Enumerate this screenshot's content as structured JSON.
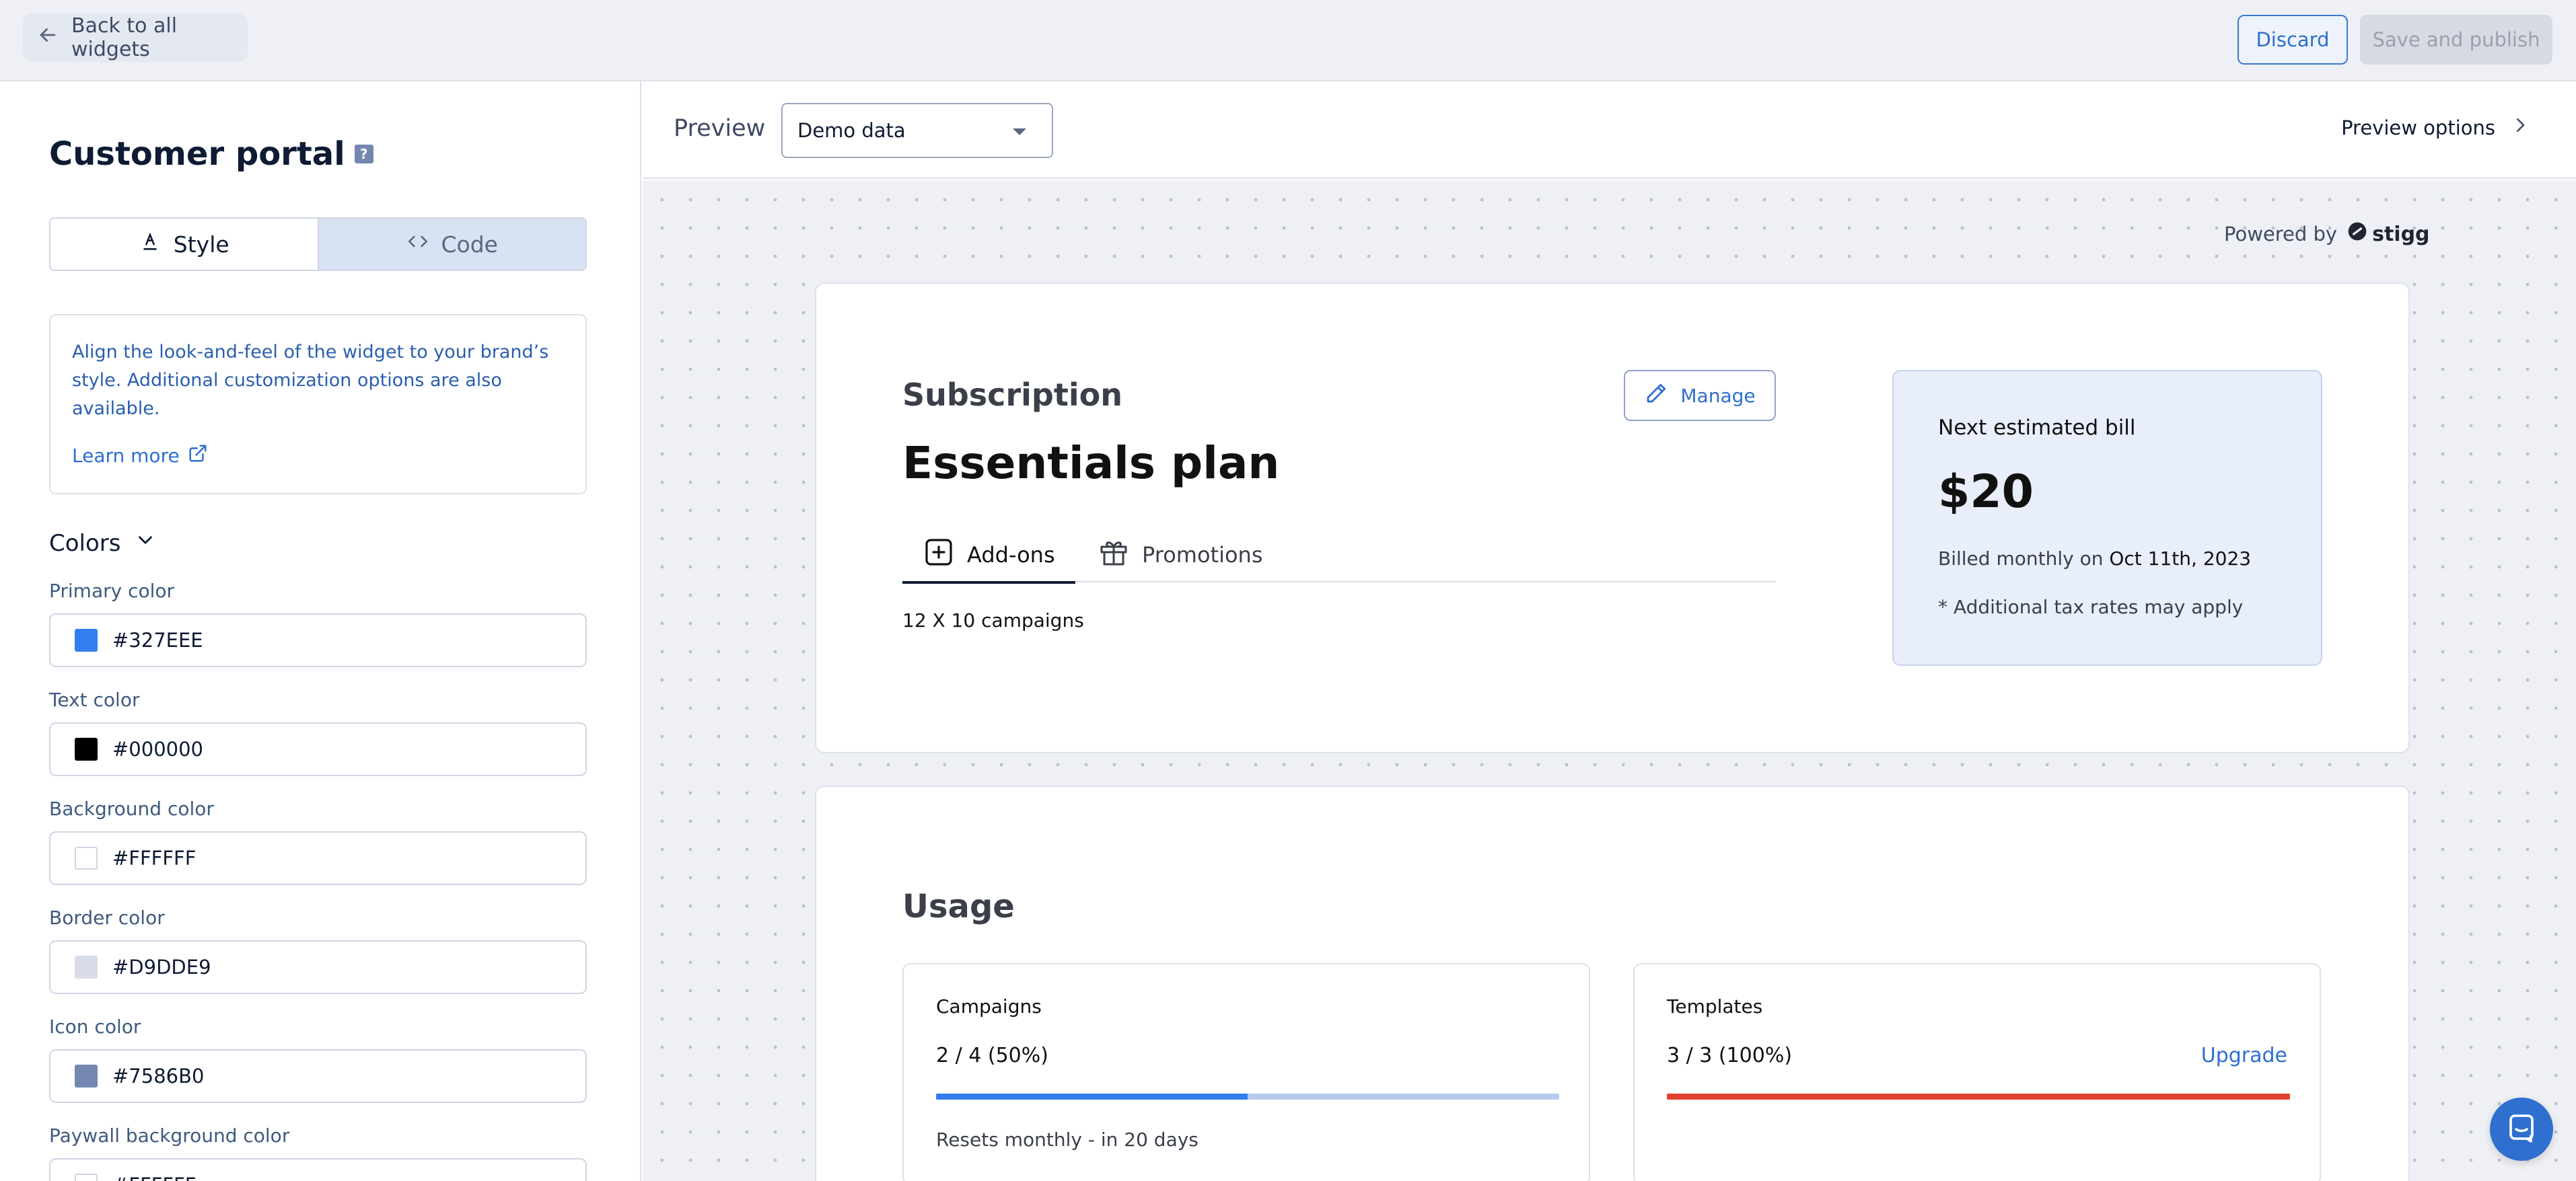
{
  "topbar": {
    "back_label": "Back to all widgets",
    "discard_label": "Discard",
    "publish_label": "Save and publish"
  },
  "left": {
    "title": "Customer portal",
    "help_icon_text": "?",
    "tabs": [
      {
        "label": "Style",
        "icon": "pen-icon",
        "active": true
      },
      {
        "label": "Code",
        "icon": "code-icon",
        "active": false
      }
    ],
    "info": {
      "text": "Align the look-and-feel of the widget to your brand’s style. Additional customization options are also available.",
      "link": "Learn more"
    },
    "colors_heading": "Colors",
    "color_fields": [
      {
        "label": "Primary color",
        "value": "#327EEE",
        "swatch": "#327EEE"
      },
      {
        "label": "Text color",
        "value": "#000000",
        "swatch": "#000000"
      },
      {
        "label": "Background color",
        "value": "#FFFFFF",
        "swatch": "#FFFFFF"
      },
      {
        "label": "Border color",
        "value": "#D9DDE9",
        "swatch": "#D9DDE9"
      },
      {
        "label": "Icon color",
        "value": "#7586B0",
        "swatch": "#7586B0"
      },
      {
        "label": "Paywall background color",
        "value": "#FFFFFF",
        "swatch": "#FFFFFF"
      }
    ]
  },
  "preview": {
    "label": "Preview",
    "select_value": "Demo data",
    "options_label": "Preview options",
    "powered_by": "Powered by",
    "brand": "stigg"
  },
  "subscription": {
    "heading": "Subscription",
    "plan": "Essentials plan",
    "manage_label": "Manage",
    "tabs": [
      {
        "label": "Add-ons",
        "icon": "plus-square-icon",
        "active": true
      },
      {
        "label": "Promotions",
        "icon": "gift-icon",
        "active": false
      }
    ],
    "addon_line": "12 X 10 campaigns",
    "bill": {
      "heading": "Next estimated bill",
      "amount": "$20",
      "billed_prefix": "Billed monthly on ",
      "billed_date": "Oct 11th, 2023",
      "note": "* Additional tax rates may apply"
    }
  },
  "usage": {
    "heading": "Usage",
    "items": [
      {
        "name": "Campaigns",
        "value": "2 / 4 (50%)",
        "fraction": 0.5,
        "bar_color": "#327EEE",
        "reset": "Resets monthly - in 20 days",
        "upgrade": ""
      },
      {
        "name": "Templates",
        "value": "3 / 3 (100%)",
        "fraction": 1.0,
        "bar_color": "#E0432F",
        "reset": "",
        "upgrade": "Upgrade"
      }
    ]
  },
  "colors": {
    "accent": "#2E6FD0",
    "danger": "#E0432F"
  }
}
